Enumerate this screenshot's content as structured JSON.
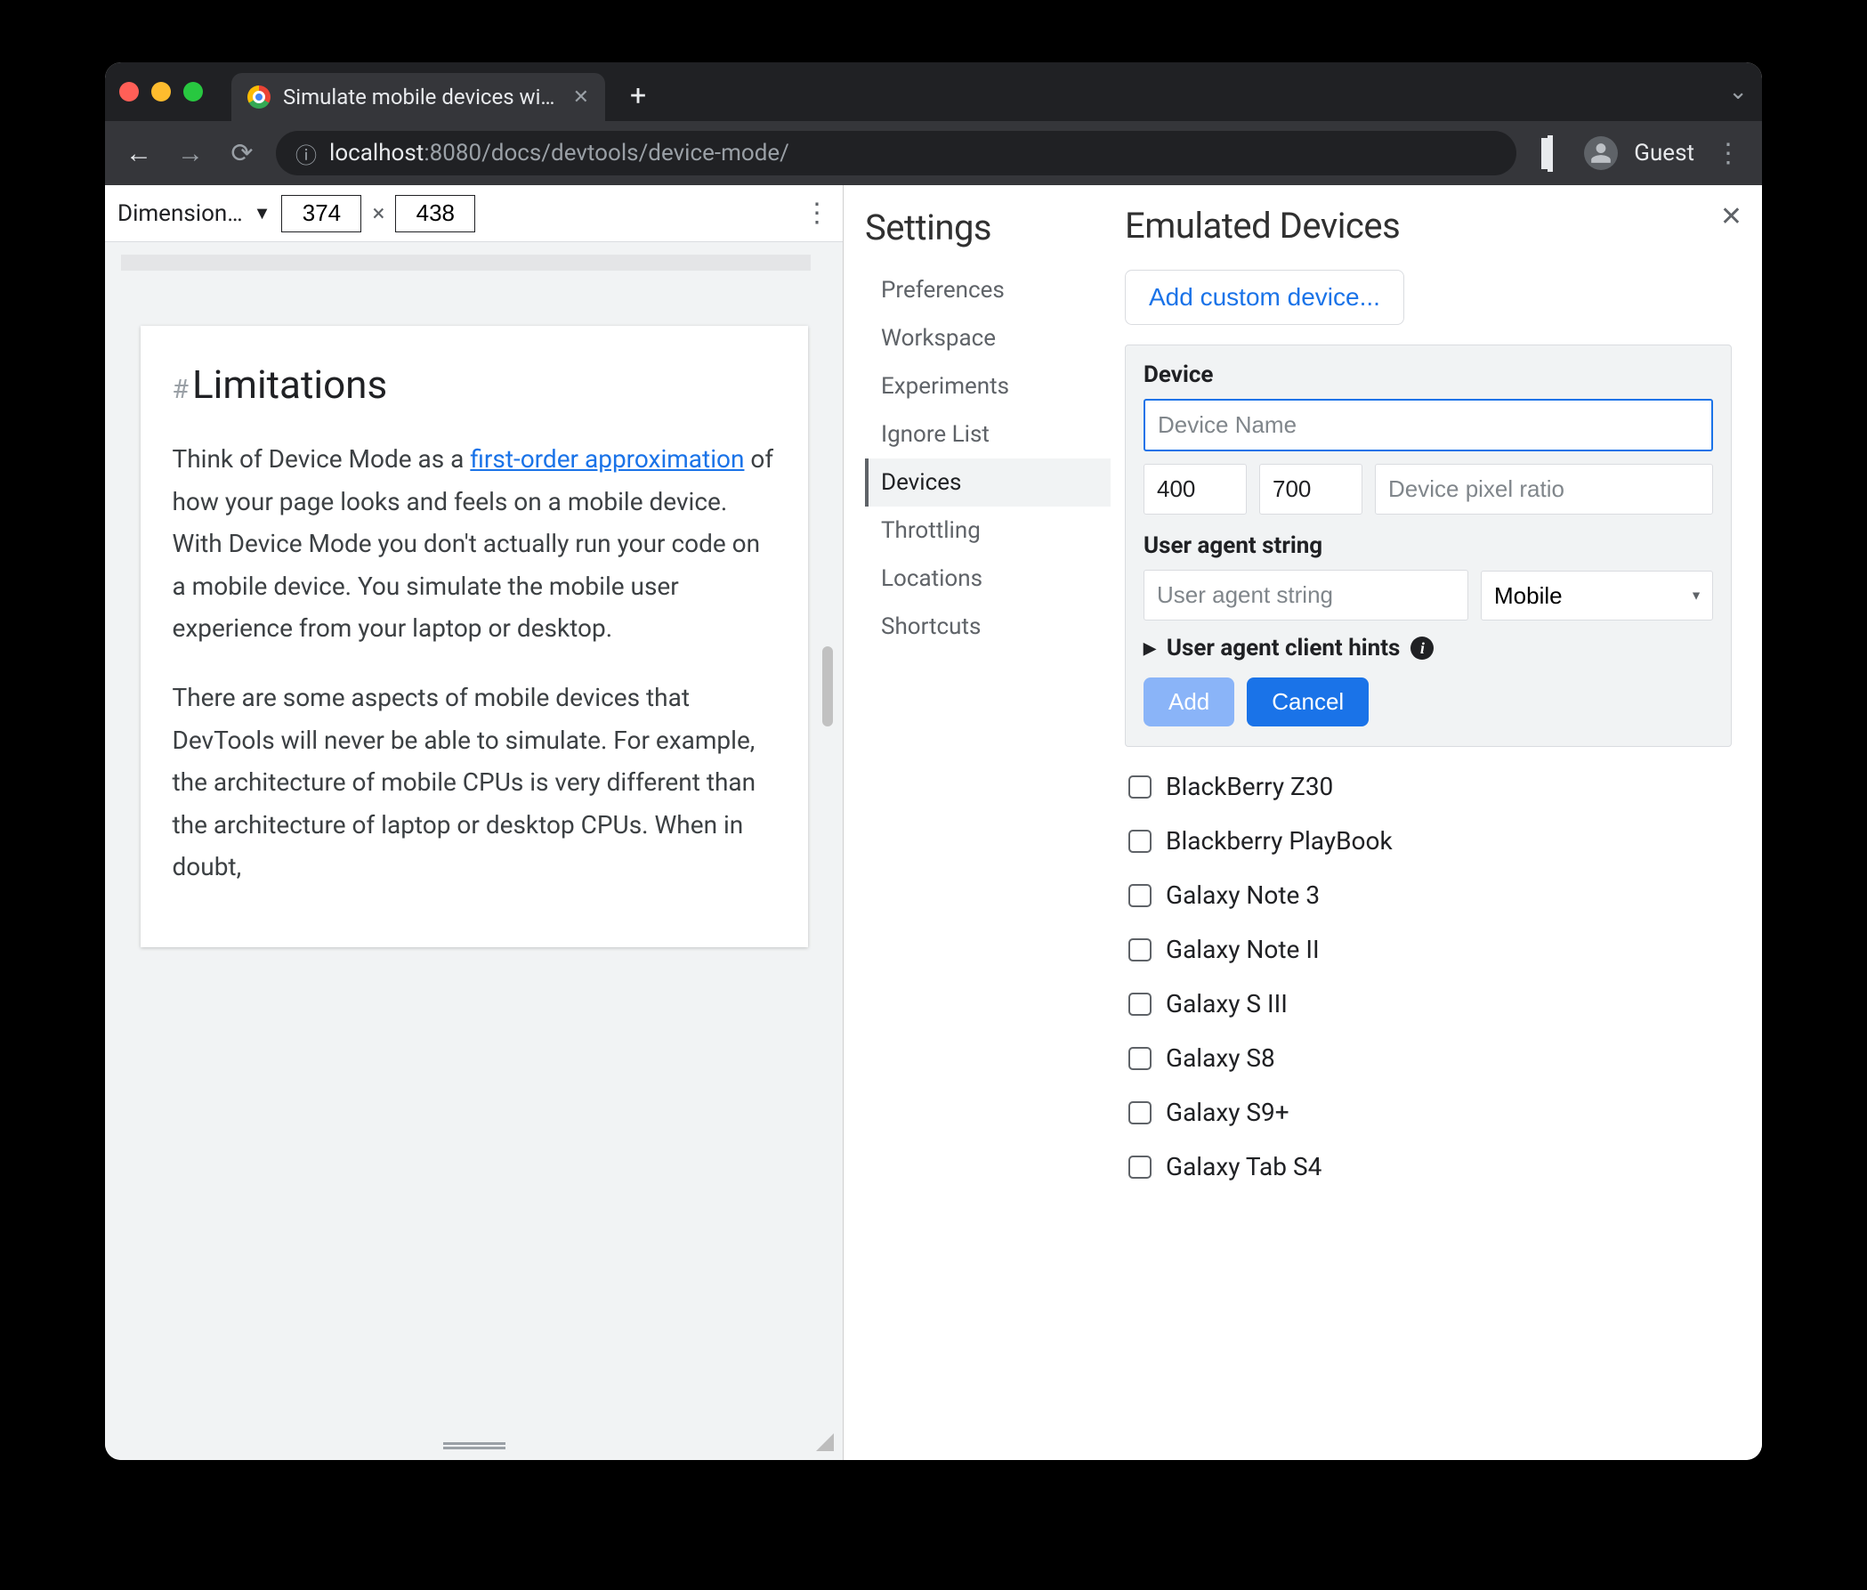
{
  "tab": {
    "title": "Simulate mobile devices with D"
  },
  "urlbar": {
    "host": "localhost",
    "port": ":8080",
    "path": "/docs/devtools/device-mode/",
    "guest_label": "Guest"
  },
  "device_toolbar": {
    "dimensions_label": "Dimension…",
    "width": "374",
    "height": "438",
    "separator": "×"
  },
  "page_content": {
    "heading": "Limitations",
    "p1_prefix": "Think of Device Mode as a ",
    "p1_link": "first-order approximation",
    "p1_suffix": " of how your page looks and feels on a mobile device. With Device Mode you don't actually run your code on a mobile device. You simulate the mobile user experience from your laptop or desktop.",
    "p2": "There are some aspects of mobile devices that DevTools will never be able to simulate. For example, the architecture of mobile CPUs is very different than the architecture of laptop or desktop CPUs. When in doubt,"
  },
  "settings": {
    "title": "Settings",
    "items": [
      "Preferences",
      "Workspace",
      "Experiments",
      "Ignore List",
      "Devices",
      "Throttling",
      "Locations",
      "Shortcuts"
    ],
    "active_index": 4
  },
  "emulated": {
    "title": "Emulated Devices",
    "add_custom_label": "Add custom device...",
    "device_section_label": "Device",
    "device_name_placeholder": "Device Name",
    "width_value": "400",
    "height_value": "700",
    "dpr_placeholder": "Device pixel ratio",
    "ua_section_label": "User agent string",
    "ua_placeholder": "User agent string",
    "ua_type_selected": "Mobile",
    "hints_label": "User agent client hints",
    "add_label": "Add",
    "cancel_label": "Cancel",
    "devices": [
      "BlackBerry Z30",
      "Blackberry PlayBook",
      "Galaxy Note 3",
      "Galaxy Note II",
      "Galaxy S III",
      "Galaxy S8",
      "Galaxy S9+",
      "Galaxy Tab S4"
    ]
  }
}
